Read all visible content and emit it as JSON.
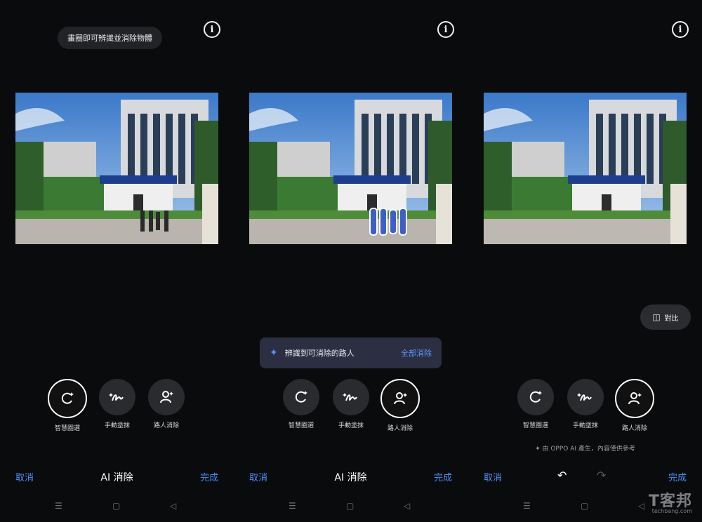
{
  "panels": [
    {
      "tooltip": "畫圈即可辨識並消除物體",
      "tools": [
        {
          "label": "智慧圈選",
          "icon": "smart-select-icon"
        },
        {
          "label": "手動塗抹",
          "icon": "brush-icon"
        },
        {
          "label": "路人消除",
          "icon": "remove-passerby-icon"
        }
      ],
      "active_tool": 0,
      "bar": {
        "cancel": "取消",
        "title": "AI 消除",
        "done": "完成"
      },
      "photo_state": "original"
    },
    {
      "toast": {
        "message": "辨識到可消除的路人",
        "action": "全部消除"
      },
      "tools": [
        {
          "label": "智慧圈選",
          "icon": "smart-select-icon"
        },
        {
          "label": "手動塗抹",
          "icon": "brush-icon"
        },
        {
          "label": "路人消除",
          "icon": "remove-passerby-icon"
        }
      ],
      "active_tool": 2,
      "bar": {
        "cancel": "取消",
        "title": "AI 消除",
        "done": "完成"
      },
      "photo_state": "people-highlighted"
    },
    {
      "compare_label": "對比",
      "ai_note": "由 OPPO AI 產生，內容僅供參考",
      "tools": [
        {
          "label": "智慧圈選",
          "icon": "smart-select-icon"
        },
        {
          "label": "手動塗抹",
          "icon": "brush-icon"
        },
        {
          "label": "路人消除",
          "icon": "remove-passerby-icon"
        }
      ],
      "active_tool": 2,
      "bar": {
        "cancel": "取消",
        "done": "完成"
      },
      "photo_state": "people-removed"
    }
  ],
  "watermark": {
    "big": "T客邦",
    "small": "techbang.com"
  },
  "colors": {
    "accent": "#4b8df5",
    "toast_bg": "#2c2f42",
    "background": "#0a0b0d"
  }
}
